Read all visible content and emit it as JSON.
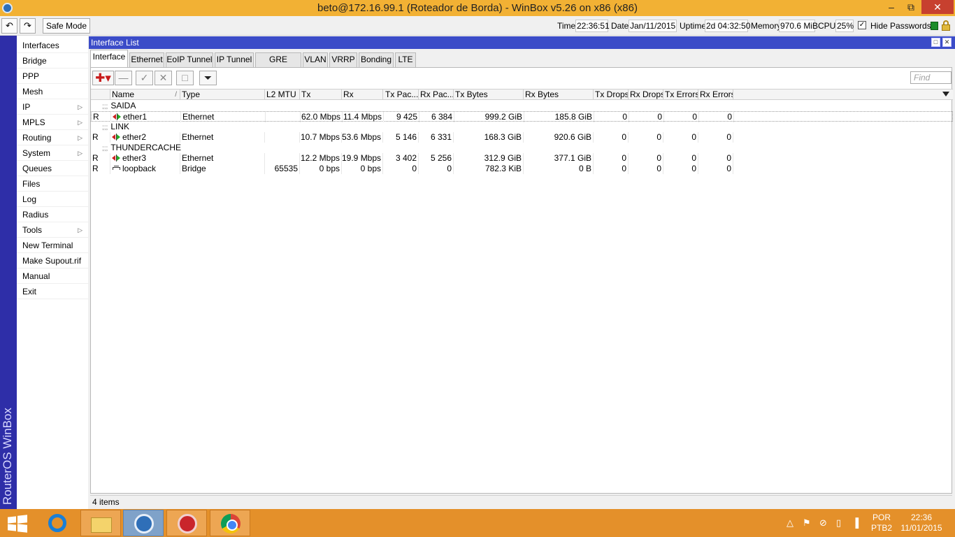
{
  "window": {
    "title": "beto@172.16.99.1 (Roteador de Borda) - WinBox v5.26 on x86 (x86)",
    "min_glyph": "–",
    "max_glyph": "⧉",
    "close_glyph": "✕"
  },
  "toolbar": {
    "undo_glyph": "↶",
    "redo_glyph": "↷",
    "safe_mode_label": "Safe Mode",
    "time_label": "Time:",
    "time_value": "22:36:51",
    "date_label": "Date:",
    "date_value": "Jan/11/2015",
    "uptime_label": "Uptime:",
    "uptime_value": "2d 04:32:50",
    "memory_label": "Memory:",
    "memory_value": "970.6 MiB",
    "cpu_label": "CPU:",
    "cpu_value": "25%",
    "hide_passwords_checked": "✓",
    "hide_passwords_label": "Hide Passwords"
  },
  "brand": "RouterOS WinBox",
  "menu": {
    "items": [
      {
        "label": "Interfaces",
        "arrow": ""
      },
      {
        "label": "Bridge",
        "arrow": ""
      },
      {
        "label": "PPP",
        "arrow": ""
      },
      {
        "label": "Mesh",
        "arrow": ""
      },
      {
        "label": "IP",
        "arrow": "▷"
      },
      {
        "label": "MPLS",
        "arrow": "▷"
      },
      {
        "label": "Routing",
        "arrow": "▷"
      },
      {
        "label": "System",
        "arrow": "▷"
      },
      {
        "label": "Queues",
        "arrow": ""
      },
      {
        "label": "Files",
        "arrow": ""
      },
      {
        "label": "Log",
        "arrow": ""
      },
      {
        "label": "Radius",
        "arrow": ""
      },
      {
        "label": "Tools",
        "arrow": "▷"
      },
      {
        "label": "New Terminal",
        "arrow": ""
      },
      {
        "label": "Make Supout.rif",
        "arrow": ""
      },
      {
        "label": "Manual",
        "arrow": ""
      },
      {
        "label": "Exit",
        "arrow": ""
      }
    ]
  },
  "interface_window": {
    "title": "Interface List",
    "tabs": [
      "Interface",
      "Ethernet",
      "EoIP Tunnel",
      "IP Tunnel",
      "GRE Tunnel",
      "VLAN",
      "VRRP",
      "Bonding",
      "LTE"
    ],
    "tool_add": "✚▾",
    "tool_remove": "—",
    "tool_enable": "✓",
    "tool_disable": "✕",
    "tool_comment": "□",
    "tool_filter": "⏷",
    "find_placeholder": "Find",
    "sort_marker": "/",
    "columns": [
      "Name",
      "Type",
      "L2 MTU",
      "Tx",
      "Rx",
      "Tx Pac...",
      "Rx Pac...",
      "Tx Bytes",
      "Rx Bytes",
      "Tx Drops",
      "Rx Drops",
      "Tx Errors",
      "Rx Errors"
    ],
    "comment_dots": ";;;",
    "rows": [
      {
        "kind": "comment",
        "text": "SAIDA"
      },
      {
        "kind": "iface",
        "flag": "R",
        "icon": "ethernet",
        "name": "ether1",
        "type": "Ethernet",
        "l2mtu": "",
        "tx": "62.0 Mbps",
        "rx": "11.4 Mbps",
        "txp": "9 425",
        "rxp": "6 384",
        "txb": "999.2 GiB",
        "rxb": "185.8 GiB",
        "txd": "0",
        "rxd": "0",
        "txe": "0",
        "rxe": "0",
        "selected": true
      },
      {
        "kind": "comment",
        "text": "LINK"
      },
      {
        "kind": "iface",
        "flag": "R",
        "icon": "ethernet",
        "name": "ether2",
        "type": "Ethernet",
        "l2mtu": "",
        "tx": "10.7 Mbps",
        "rx": "53.6 Mbps",
        "txp": "5 146",
        "rxp": "6 331",
        "txb": "168.3 GiB",
        "rxb": "920.6 GiB",
        "txd": "0",
        "rxd": "0",
        "txe": "0",
        "rxe": "0"
      },
      {
        "kind": "comment",
        "text": "THUNDERCACHE"
      },
      {
        "kind": "iface",
        "flag": "R",
        "icon": "ethernet",
        "name": "ether3",
        "type": "Ethernet",
        "l2mtu": "",
        "tx": "12.2 Mbps",
        "rx": "19.9 Mbps",
        "txp": "3 402",
        "rxp": "5 256",
        "txb": "312.9 GiB",
        "rxb": "377.1 GiB",
        "txd": "0",
        "rxd": "0",
        "txe": "0",
        "rxe": "0"
      },
      {
        "kind": "iface",
        "flag": "R",
        "icon": "bridge",
        "name": "loopback",
        "type": "Bridge",
        "l2mtu": "65535",
        "tx": "0 bps",
        "rx": "0 bps",
        "txp": "0",
        "rxp": "0",
        "txb": "782.3 KiB",
        "rxb": "0 B",
        "txd": "0",
        "rxd": "0",
        "txe": "0",
        "rxe": "0"
      }
    ],
    "status_text": "4 items"
  },
  "taskbar": {
    "tray_glyphs": [
      "△",
      "⚑",
      "⊘",
      "▯",
      "▐"
    ],
    "lang_top": "POR",
    "lang_bottom": "PTB2",
    "time": "22:36",
    "date": "11/01/2015"
  }
}
